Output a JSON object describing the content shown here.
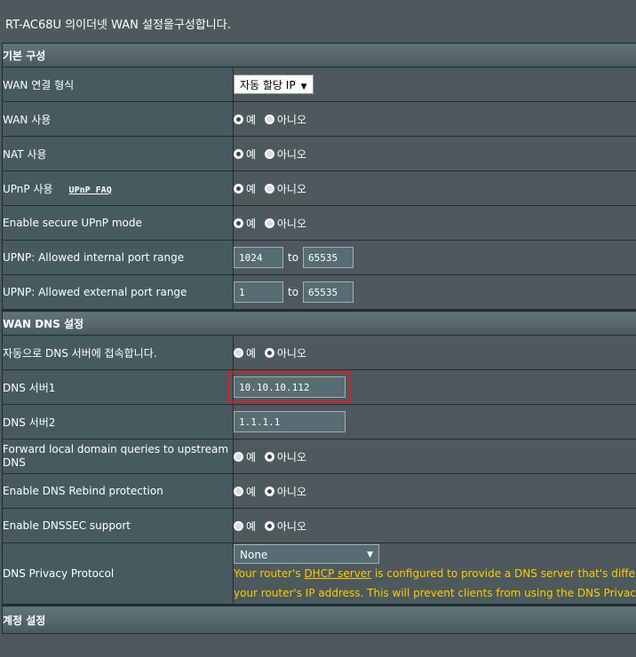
{
  "header": {
    "intro": "RT-AC68U 의이더넷 WAN 설정을구성합니다."
  },
  "basic": {
    "title": "기본 구성",
    "wan_type": {
      "label": "WAN 연결 형식",
      "value": "자동 할당 IP"
    },
    "wan_enable": {
      "label": "WAN 사용",
      "yes": "예",
      "no": "아니오"
    },
    "nat_enable": {
      "label": "NAT 사용",
      "yes": "예",
      "no": "아니오"
    },
    "upnp_enable": {
      "label": "UPnP 사용",
      "faq": "UPnP FAQ",
      "yes": "예",
      "no": "아니오"
    },
    "secure_upnp": {
      "label": "Enable secure UPnP mode",
      "yes": "예",
      "no": "아니오"
    },
    "internal_range": {
      "label": "UPNP: Allowed internal port range",
      "from": "1024",
      "to_label": "to",
      "to": "65535"
    },
    "external_range": {
      "label": "UPNP: Allowed external port range",
      "from": "1",
      "to_label": "to",
      "to": "65535"
    }
  },
  "dns": {
    "title": "WAN DNS 설정",
    "auto_dns": {
      "label": "자동으로 DNS 서버에 접속합니다.",
      "yes": "예",
      "no": "아니오"
    },
    "dns1": {
      "label": "DNS 서버1",
      "value": "10.10.10.112"
    },
    "dns2": {
      "label": "DNS 서버2",
      "value": "1.1.1.1"
    },
    "forward_local": {
      "label": "Forward local domain queries to upstream DNS",
      "yes": "예",
      "no": "아니오"
    },
    "rebind": {
      "label": "Enable DNS Rebind protection",
      "yes": "예",
      "no": "아니오"
    },
    "dnssec": {
      "label": "Enable DNSSEC support",
      "yes": "예",
      "no": "아니오"
    },
    "privacy": {
      "label": "DNS Privacy Protocol",
      "value": "None",
      "note_prefix": "Your router's ",
      "note_link": "DHCP server",
      "note_line1_rest": " is configured to provide a DNS server that's different from",
      "note_line2": "your router's IP address. This will prevent clients from using the DNS Privacy server"
    }
  },
  "account": {
    "title": "계정 설정"
  }
}
